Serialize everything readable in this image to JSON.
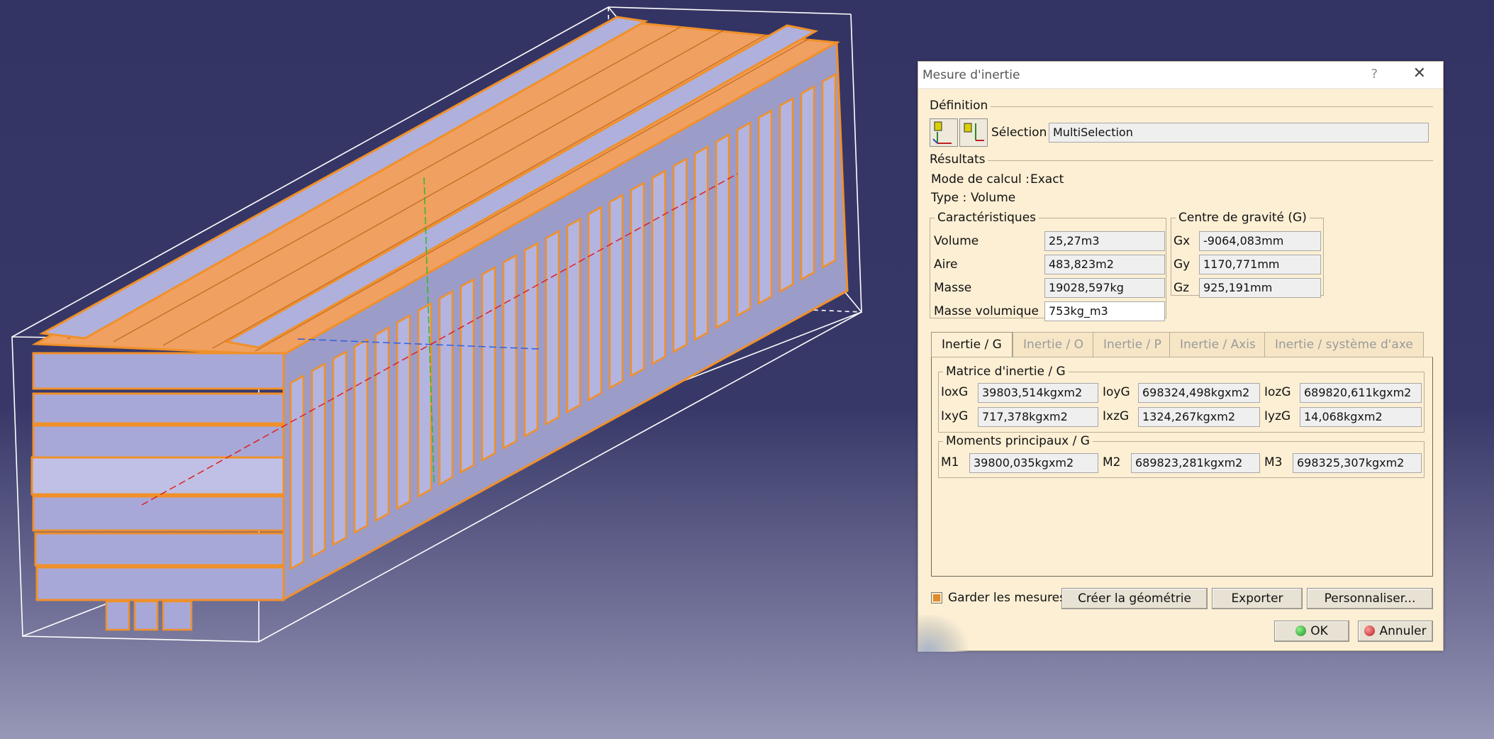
{
  "dialog": {
    "title": "Mesure d'inertie",
    "help_glyph": "?",
    "close_glyph": "✕",
    "definition": {
      "title": "Définition",
      "selection_label": "Sélection :",
      "selection_value": "MultiSelection"
    },
    "results": {
      "title": "Résultats",
      "mode_label": "Mode de calcul :",
      "mode_value": "Exact",
      "type_label": "Type :",
      "type_value": "Volume"
    },
    "characteristics": {
      "title": "Caractéristiques",
      "rows": [
        {
          "label": "Volume",
          "value": "25,27m3"
        },
        {
          "label": "Aire",
          "value": "483,823m2"
        },
        {
          "label": "Masse",
          "value": "19028,597kg"
        },
        {
          "label": "Masse volumique",
          "value": "753kg_m3"
        }
      ]
    },
    "gravity": {
      "title": "Centre de gravité (G)",
      "rows": [
        {
          "label": "Gx",
          "value": "-9064,083mm"
        },
        {
          "label": "Gy",
          "value": "1170,771mm"
        },
        {
          "label": "Gz",
          "value": "925,191mm"
        }
      ]
    },
    "tabs": [
      {
        "label": "Inertie / G",
        "active": true
      },
      {
        "label": "Inertie / O",
        "active": false
      },
      {
        "label": "Inertie / P",
        "active": false
      },
      {
        "label": "Inertie / Axis",
        "active": false
      },
      {
        "label": "Inertie / système d'axe",
        "active": false
      }
    ],
    "matrix": {
      "title": "Matrice d'inertie / G",
      "cells": [
        {
          "label": "IoxG",
          "value": "39803,514kgxm2"
        },
        {
          "label": "IoyG",
          "value": "698324,498kgxm2"
        },
        {
          "label": "IozG",
          "value": "689820,611kgxm2"
        },
        {
          "label": "IxyG",
          "value": "717,378kgxm2"
        },
        {
          "label": "IxzG",
          "value": "1324,267kgxm2"
        },
        {
          "label": "IyzG",
          "value": "14,068kgxm2"
        }
      ]
    },
    "moments": {
      "title": "Moments principaux / G",
      "cells": [
        {
          "label": "M1",
          "value": "39800,035kgxm2"
        },
        {
          "label": "M2",
          "value": "689823,281kgxm2"
        },
        {
          "label": "M3",
          "value": "698325,307kgxm2"
        }
      ]
    },
    "keep_label": "Garder les mesures",
    "buttons": {
      "create_geometry": "Créer la géométrie",
      "export": "Exporter",
      "customize": "Personnaliser...",
      "ok": "OK",
      "cancel": "Annuler"
    },
    "colors": {
      "dialog_bg": "#fcefd4",
      "ok_dot": "#2aa52a",
      "cancel_dot": "#d23030",
      "model_edge": "#f0902a",
      "model_face": "#a8a8d8"
    },
    "icons": [
      "inertia-3d-icon",
      "inertia-2d-icon"
    ]
  }
}
